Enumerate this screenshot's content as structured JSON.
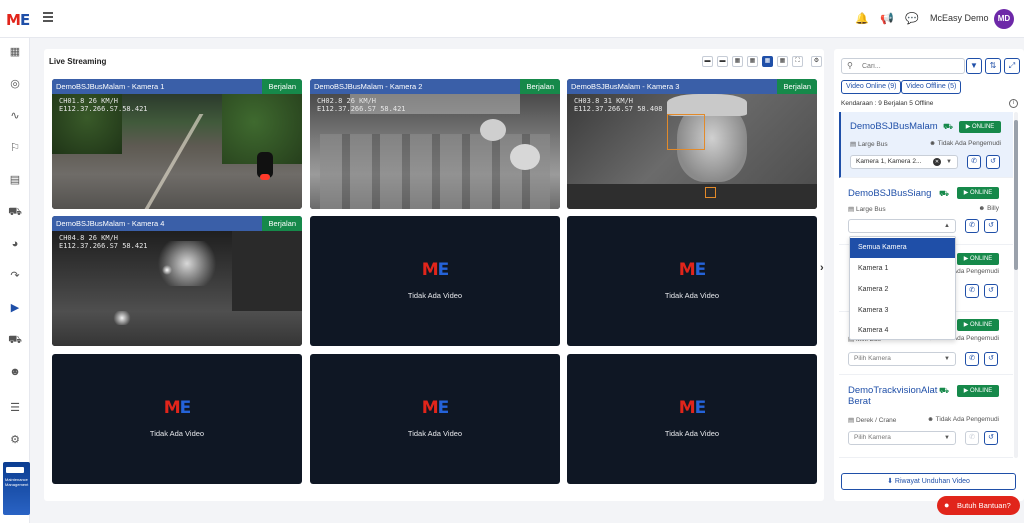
{
  "brand": {
    "logo_m": "M",
    "logo_e": "E"
  },
  "header": {
    "user_name": "McEasy Demo",
    "avatar_initials": "MD",
    "icons": [
      "bell-icon",
      "megaphone-icon",
      "chat-icon"
    ]
  },
  "sidebar": {
    "items": [
      "dashboard-icon",
      "location-icon",
      "activity-icon",
      "alert-icon",
      "report-icon",
      "truck-icon",
      "fuel-icon",
      "route-icon",
      "video-icon",
      "delivery-icon",
      "driver-icon",
      "layers-icon",
      "settings-icon"
    ],
    "promo_text": "Maintenance Management"
  },
  "main": {
    "title": "Live Streaming",
    "layout_buttons": [
      "1x1",
      "1x2",
      "2x2",
      "2x3",
      "3x3",
      "grid",
      "fullscreen",
      "settings"
    ],
    "active_layout_index": 4,
    "tiles": [
      {
        "title": "DemoBSJBusMalam - Kamera 1",
        "status": "Berjalan",
        "osd": "CH01.8 26 KM/H\nE112.37.266.S7.58.421",
        "scene": "road"
      },
      {
        "title": "DemoBSJBusMalam - Kamera 2",
        "status": "Berjalan",
        "osd": "CH02.8 26 KM/H\nE112.37.266.S7 58.421",
        "scene": "bus"
      },
      {
        "title": "DemoBSJBusMalam - Kamera 3",
        "status": "Berjalan",
        "osd": "CH03.8 31 KM/H\nE112.37.266.S7 58.408",
        "scene": "driver"
      },
      {
        "title": "DemoBSJBusMalam - Kamera 4",
        "status": "Berjalan",
        "osd": "CH04.8 26 KM/H\nE112.37.266.S7 58.421",
        "scene": "night"
      }
    ],
    "no_video_text": "Tidak Ada Video"
  },
  "right_panel": {
    "search_placeholder": "Cari...",
    "video_online_label": "Video Online (9)",
    "video_offline_label": "Video Offline (5)",
    "kendaraan_label": "Kendaraan : 9 Berjalan 5 Offline",
    "online_label": "ONLINE",
    "vehicles": [
      {
        "name": "DemoBSJBusMalam",
        "type": "Large Bus",
        "driver": "Tidak Ada Pengemudi",
        "camera": "Kamera 1, Kamera 2...",
        "selected": true
      },
      {
        "name": "DemoBSJBusSiang",
        "type": "Large Bus",
        "driver": "Billy",
        "camera": "",
        "selected": false
      },
      {
        "name": "",
        "type": "",
        "driver": "Tidak Ada Pengemudi",
        "camera": "",
        "selected": false
      },
      {
        "name": "",
        "type": "Mini Bus",
        "driver": "Tidak Ada Pengemudi",
        "camera": "Pilih Kamera",
        "selected": false
      },
      {
        "name": "DemoTrackvisionAlat Berat",
        "type": "Derek / Crane",
        "driver": "Tidak Ada Pengemudi",
        "camera": "Pilih Kamera",
        "selected": false
      }
    ],
    "dropdown_options": [
      "Semua Kamera",
      "Kamera 1",
      "Kamera 2",
      "Kamera 3",
      "Kamera 4"
    ],
    "dropdown_selected": 0,
    "riwayat_label": "Riwayat Unduhan Video"
  },
  "help_label": "Butuh Bantuan?",
  "colors": {
    "primary": "#1f4fa8",
    "success": "#16894a",
    "danger": "#e1251b",
    "avatar": "#6d28a8"
  }
}
